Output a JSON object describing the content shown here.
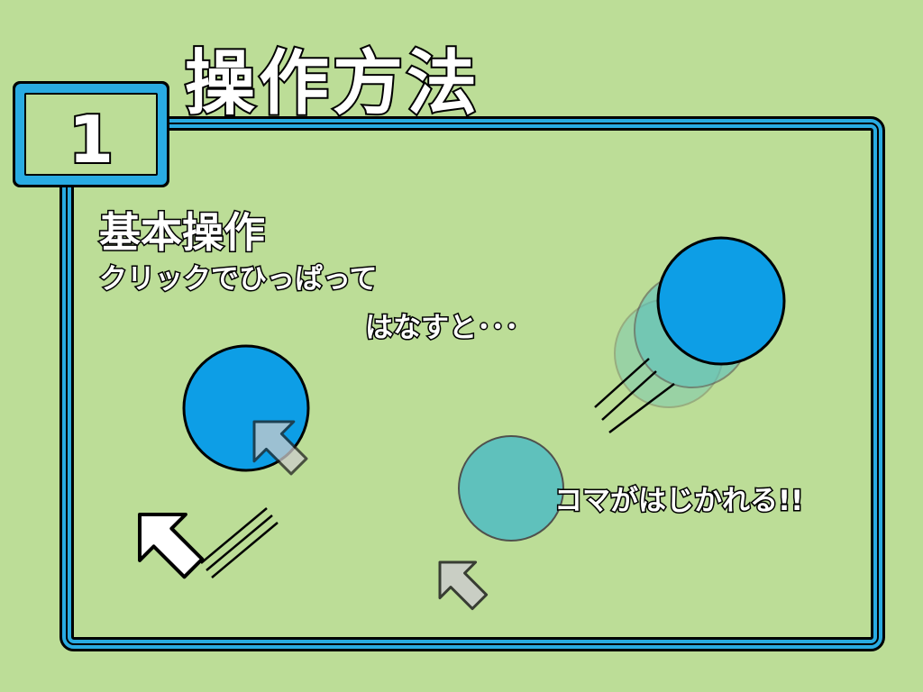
{
  "page": {
    "title": "操作方法",
    "step_number": "1",
    "section_title": "基本操作",
    "instruction_line1": "クリックでひっぱって",
    "instruction_line2": "はなすと･･･",
    "instruction_line3": "コマがはじかれる!!"
  },
  "colors": {
    "background": "#bcdd97",
    "frame": "#29abe2",
    "piece": "#0d9ee6",
    "piece_moving": "#5bc0be",
    "cursor_white": "#ffffff",
    "cursor_gray": "#cccccc"
  },
  "icons": [
    "cursor-arrow-icon"
  ]
}
